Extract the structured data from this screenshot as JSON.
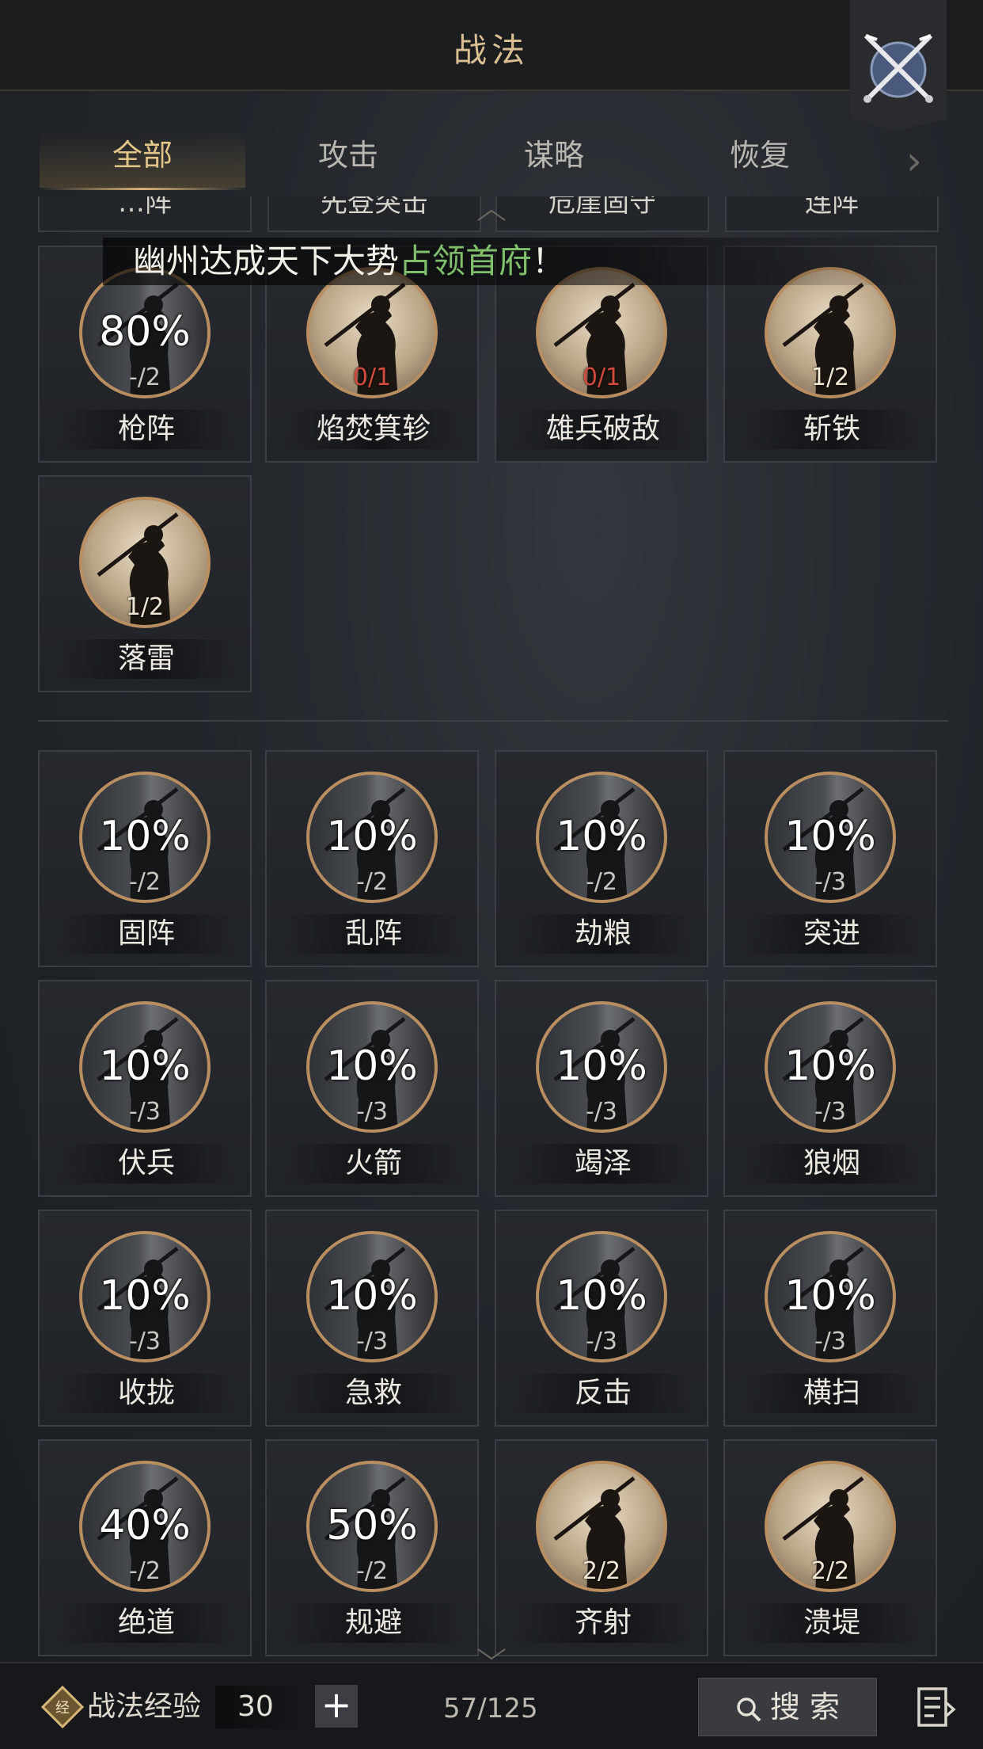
{
  "header": {
    "title": "战法",
    "close_icon": "crossed-swords-icon"
  },
  "tabs": [
    {
      "label": "全部",
      "active": true
    },
    {
      "label": "攻击",
      "active": false
    },
    {
      "label": "谋略",
      "active": false
    },
    {
      "label": "恢复",
      "active": false
    }
  ],
  "cut_row": [
    "…阵",
    "先登突击",
    "危崖固守",
    "连阵"
  ],
  "banner": {
    "prefix": "幽州达成天下大势",
    "highlight": "占领首府",
    "suffix": "！"
  },
  "upper_cards": [
    {
      "name": "枪阵",
      "percent": "80%",
      "count": "-/2",
      "state": "locked-partial",
      "count_color": "normal"
    },
    {
      "name": "焰焚箕轸",
      "percent": "",
      "count": "0/1",
      "state": "unlocked",
      "count_color": "red"
    },
    {
      "name": "雄兵破敌",
      "percent": "",
      "count": "0/1",
      "state": "unlocked",
      "count_color": "red"
    },
    {
      "name": "斩铁",
      "percent": "",
      "count": "1/2",
      "state": "unlocked",
      "count_color": "normal"
    },
    {
      "name": "落雷",
      "percent": "",
      "count": "1/2",
      "state": "unlocked",
      "count_color": "normal"
    }
  ],
  "lower_cards": [
    {
      "name": "固阵",
      "percent": "10%",
      "count": "-/2",
      "state": "locked"
    },
    {
      "name": "乱阵",
      "percent": "10%",
      "count": "-/2",
      "state": "locked"
    },
    {
      "name": "劫粮",
      "percent": "10%",
      "count": "-/2",
      "state": "locked"
    },
    {
      "name": "突进",
      "percent": "10%",
      "count": "-/3",
      "state": "locked"
    },
    {
      "name": "伏兵",
      "percent": "10%",
      "count": "-/3",
      "state": "locked"
    },
    {
      "name": "火箭",
      "percent": "10%",
      "count": "-/3",
      "state": "locked"
    },
    {
      "name": "竭泽",
      "percent": "10%",
      "count": "-/3",
      "state": "locked"
    },
    {
      "name": "狼烟",
      "percent": "10%",
      "count": "-/3",
      "state": "locked"
    },
    {
      "name": "收拢",
      "percent": "10%",
      "count": "-/3",
      "state": "locked"
    },
    {
      "name": "急救",
      "percent": "10%",
      "count": "-/3",
      "state": "locked"
    },
    {
      "name": "反击",
      "percent": "10%",
      "count": "-/3",
      "state": "locked"
    },
    {
      "name": "横扫",
      "percent": "10%",
      "count": "-/3",
      "state": "locked"
    },
    {
      "name": "绝道",
      "percent": "40%",
      "count": "-/2",
      "state": "locked"
    },
    {
      "name": "规避",
      "percent": "50%",
      "count": "-/2",
      "state": "locked"
    },
    {
      "name": "齐射",
      "percent": "",
      "count": "2/2",
      "state": "unlocked"
    },
    {
      "name": "溃堤",
      "percent": "",
      "count": "2/2",
      "state": "unlocked"
    }
  ],
  "footer": {
    "exp_label": "战法经验",
    "exp_value": "30",
    "plus": "+",
    "page_count": "57/125",
    "search_label": "搜 索"
  },
  "colors": {
    "accent_gold": "#d4b078",
    "highlight_green": "#7fbf6b",
    "warn_red": "#d24a3c",
    "ring": "#b98e60"
  }
}
